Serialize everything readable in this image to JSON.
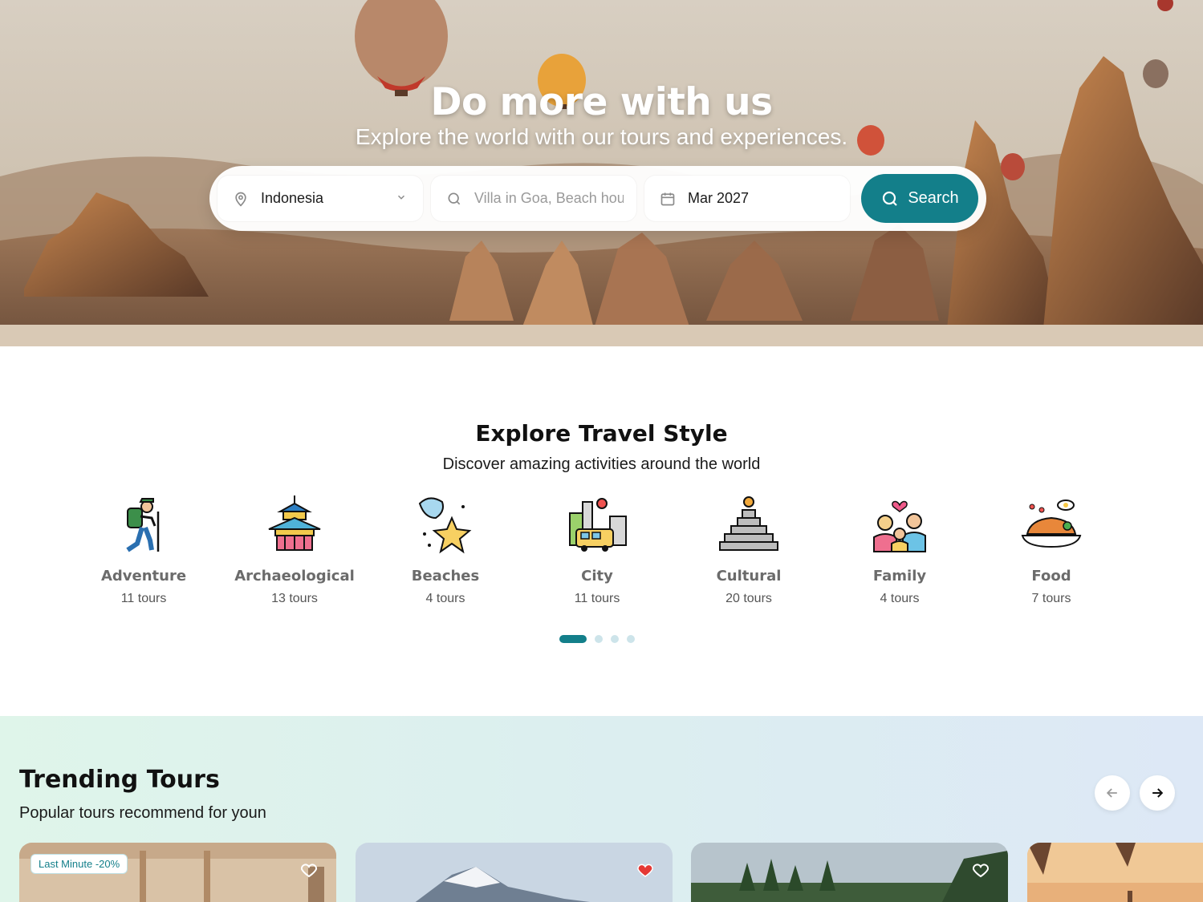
{
  "hero": {
    "title": "Do more with us",
    "subtitle": "Explore the world with our tours and experiences."
  },
  "search": {
    "location_value": "Indonesia",
    "query_placeholder": "Villa in Goa, Beach house, etc",
    "date_value": "Mar 2027",
    "button_label": "Search",
    "accent_color": "#137f8a"
  },
  "travel_style": {
    "title": "Explore Travel Style",
    "subtitle": "Discover amazing activities around the world",
    "categories": [
      {
        "name": "Adventure",
        "count": "11 tours",
        "icon": "hiker-icon"
      },
      {
        "name": "Archaeological",
        "count": "13 tours",
        "icon": "pagoda-icon"
      },
      {
        "name": "Beaches",
        "count": "4 tours",
        "icon": "starfish-shell-icon"
      },
      {
        "name": "City",
        "count": "11 tours",
        "icon": "city-bus-icon"
      },
      {
        "name": "Cultural",
        "count": "20 tours",
        "icon": "pyramid-icon"
      },
      {
        "name": "Family",
        "count": "4 tours",
        "icon": "family-icon"
      },
      {
        "name": "Food",
        "count": "7 tours",
        "icon": "food-plate-icon"
      }
    ],
    "pager": {
      "pages": 4,
      "active": 1
    }
  },
  "trending": {
    "title": "Trending Tours",
    "subtitle": "Popular tours recommend for youn",
    "cards": [
      {
        "badge": "Last Minute -20%",
        "favorited": false
      },
      {
        "badge": "",
        "favorited": true
      },
      {
        "badge": "",
        "favorited": false
      },
      {
        "badge": "",
        "favorited": false
      }
    ]
  }
}
